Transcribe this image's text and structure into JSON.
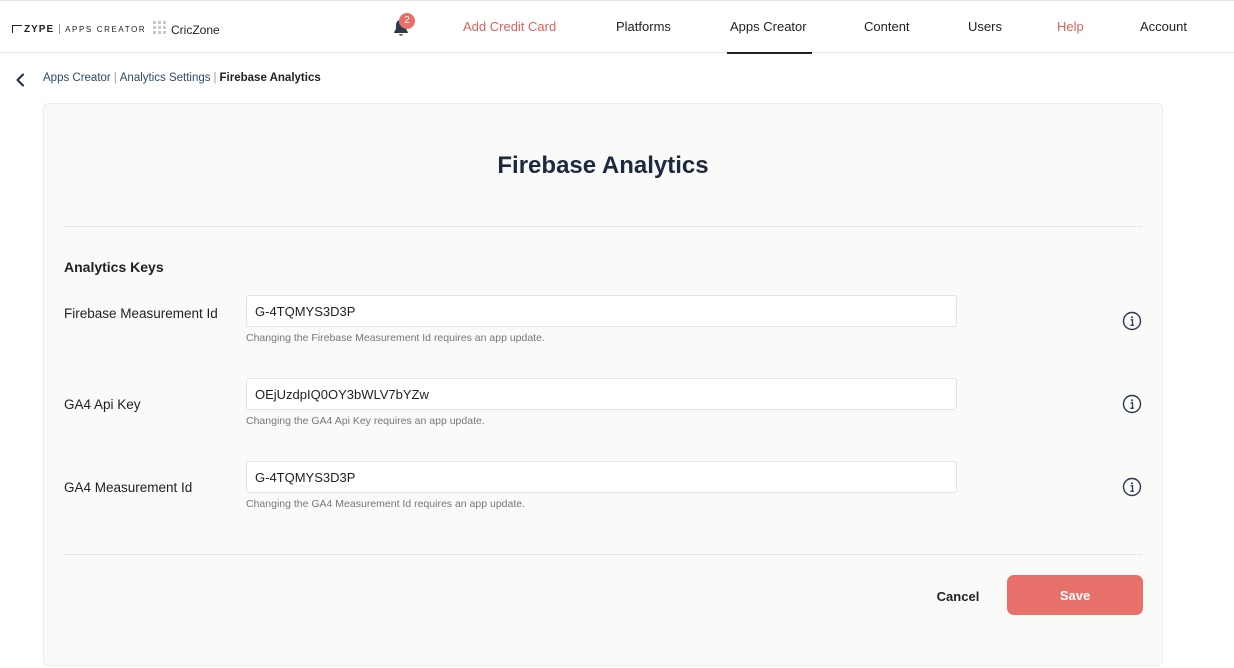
{
  "header": {
    "brand": "ZYPE",
    "product": "APPS CREATOR",
    "org_name": "CricZone",
    "notification_count": "2",
    "nav": {
      "add_credit_card": "Add Credit Card",
      "platforms": "Platforms",
      "apps_creator": "Apps Creator",
      "content": "Content",
      "users": "Users",
      "help": "Help",
      "account": "Account"
    },
    "active_nav": "Apps Creator",
    "accent_color": "#e0605a"
  },
  "breadcrumb": {
    "items": [
      "Apps Creator",
      "Analytics Settings",
      "Firebase Analytics"
    ],
    "separator": "|"
  },
  "main": {
    "title": "Firebase Analytics",
    "section_title": "Analytics Keys",
    "fields": [
      {
        "label": "Firebase Measurement Id",
        "value": "G-4TQMYS3D3P",
        "help": "Changing the Firebase Measurement Id requires an app update."
      },
      {
        "label": "GA4 Api Key",
        "value": "OEjUzdpIQ0OY3bWLV7bYZw",
        "help": "Changing the GA4 Api Key requires an app update."
      },
      {
        "label": "GA4 Measurement Id",
        "value": "G-4TQMYS3D3P",
        "help": "Changing the GA4 Measurement Id requires an app update."
      }
    ],
    "actions": {
      "cancel_label": "Cancel",
      "save_label": "Save",
      "save_color": "#e8706b"
    }
  },
  "icons": {
    "back": "chevron-left-icon",
    "bell": "bell-icon",
    "info": "info-icon",
    "org": "grid-icon"
  }
}
